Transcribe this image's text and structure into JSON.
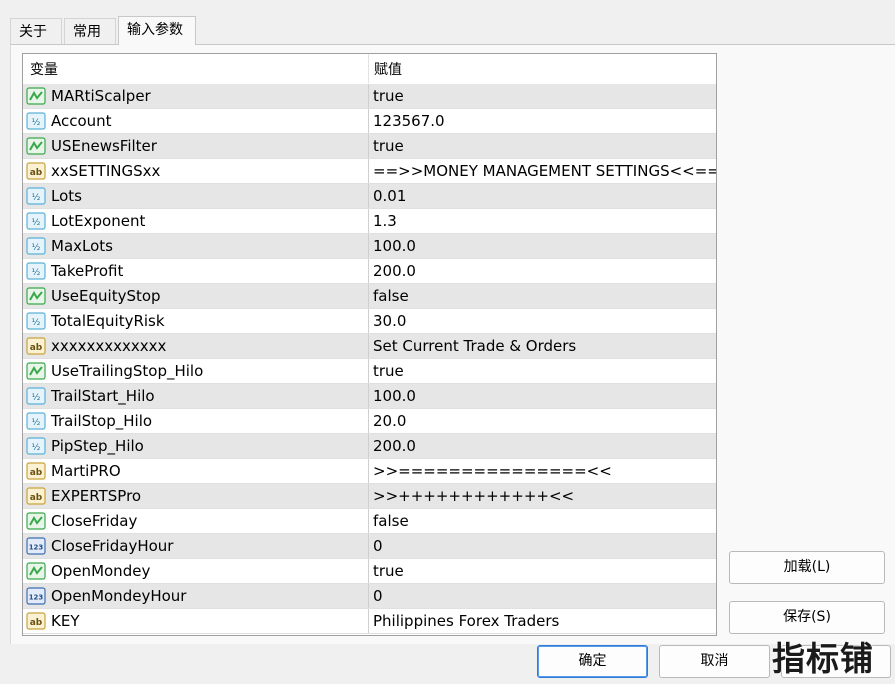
{
  "tabs": [
    {
      "label": "关于"
    },
    {
      "label": "常用"
    },
    {
      "label": "输入参数"
    }
  ],
  "grid": {
    "col_variable": "变量",
    "col_value": "赋值",
    "rows": [
      {
        "type": "bool",
        "icon": "bool-icon",
        "name": "MARtiScalper",
        "value": "true"
      },
      {
        "type": "double",
        "icon": "double-icon",
        "name": "Account",
        "value": "123567.0"
      },
      {
        "type": "bool",
        "icon": "bool-icon",
        "name": "USEnewsFilter",
        "value": "true"
      },
      {
        "type": "string",
        "icon": "string-icon",
        "name": "xxSETTINGSxx",
        "value": "==>>MONEY MANAGEMENT SETTINGS<<=="
      },
      {
        "type": "double",
        "icon": "double-icon",
        "name": "Lots",
        "value": "0.01"
      },
      {
        "type": "double",
        "icon": "double-icon",
        "name": "LotExponent",
        "value": "1.3"
      },
      {
        "type": "double",
        "icon": "double-icon",
        "name": "MaxLots",
        "value": "100.0"
      },
      {
        "type": "double",
        "icon": "double-icon",
        "name": "TakeProfit",
        "value": "200.0"
      },
      {
        "type": "bool",
        "icon": "bool-icon",
        "name": "UseEquityStop",
        "value": "false"
      },
      {
        "type": "double",
        "icon": "double-icon",
        "name": "TotalEquityRisk",
        "value": "30.0"
      },
      {
        "type": "string",
        "icon": "string-icon",
        "name": "xxxxxxxxxxxxx",
        "value": "Set Current Trade & Orders"
      },
      {
        "type": "bool",
        "icon": "bool-icon",
        "name": "UseTrailingStop_Hilo",
        "value": "true"
      },
      {
        "type": "double",
        "icon": "double-icon",
        "name": "TrailStart_Hilo",
        "value": "100.0"
      },
      {
        "type": "double",
        "icon": "double-icon",
        "name": "TrailStop_Hilo",
        "value": "20.0"
      },
      {
        "type": "double",
        "icon": "double-icon",
        "name": "PipStep_Hilo",
        "value": "200.0"
      },
      {
        "type": "string",
        "icon": "string-icon",
        "name": "MartiPRO",
        "value": ">>===============<<"
      },
      {
        "type": "string",
        "icon": "string-icon",
        "name": "EXPERTSPro",
        "value": ">>++++++++++++<<"
      },
      {
        "type": "bool",
        "icon": "bool-icon",
        "name": "CloseFriday",
        "value": "false"
      },
      {
        "type": "int",
        "icon": "int-icon",
        "name": "CloseFridayHour",
        "value": "0"
      },
      {
        "type": "bool",
        "icon": "bool-icon",
        "name": "OpenMondey",
        "value": "true"
      },
      {
        "type": "int",
        "icon": "int-icon",
        "name": "OpenMondeyHour",
        "value": "0"
      },
      {
        "type": "string",
        "icon": "string-icon",
        "name": "KEY",
        "value": "Philippines Forex Traders"
      }
    ]
  },
  "buttons": {
    "load": "加载(L)",
    "save": "保存(S)",
    "ok": "确定",
    "cancel": "取消"
  },
  "watermark": "指标铺",
  "colors": {
    "bool_icon": "#3aa84a",
    "double_icon": "#5ab0d8",
    "string_icon": "#c9a23a",
    "int_icon": "#3d6fb3",
    "row_alt": "#e6e6e6",
    "primary_border": "#2f7bd6"
  }
}
